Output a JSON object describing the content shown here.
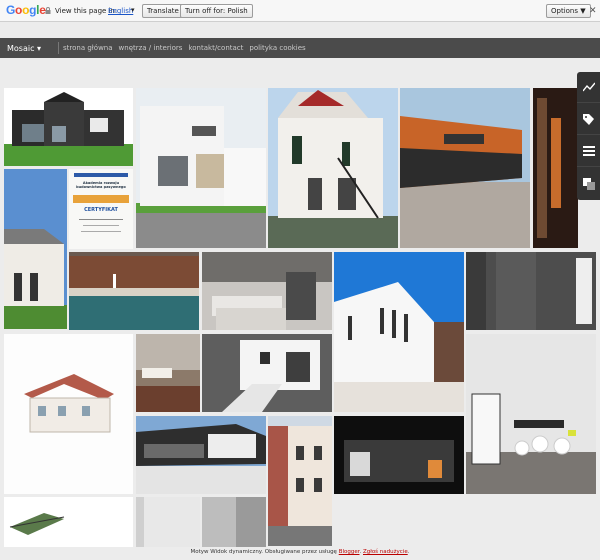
{
  "translate_bar": {
    "prompt": "View this page in:",
    "language": "English",
    "translate_button": "Translate",
    "turn_off_button": "Turn off for: Polish",
    "options_button": "Options ▼"
  },
  "nav": {
    "view_selector": "Mosaic",
    "links": [
      "strona główna",
      "wnętrza / interiors",
      "kontakt/contact",
      "polityka cookies"
    ]
  },
  "certificate": {
    "title": "Akademia rozwoju budownictwa pasywnego",
    "heading": "CERTYFIKAT"
  },
  "footer": {
    "text": "Motyw Widok dynamiczny. Obsługiwane przez usługę ",
    "blogger": "Blogger",
    "report": "Zgłoś nadużycie"
  },
  "colors": {
    "navbar": "#4b4b4b",
    "rail": "#333333",
    "link": "#1a55c8"
  }
}
